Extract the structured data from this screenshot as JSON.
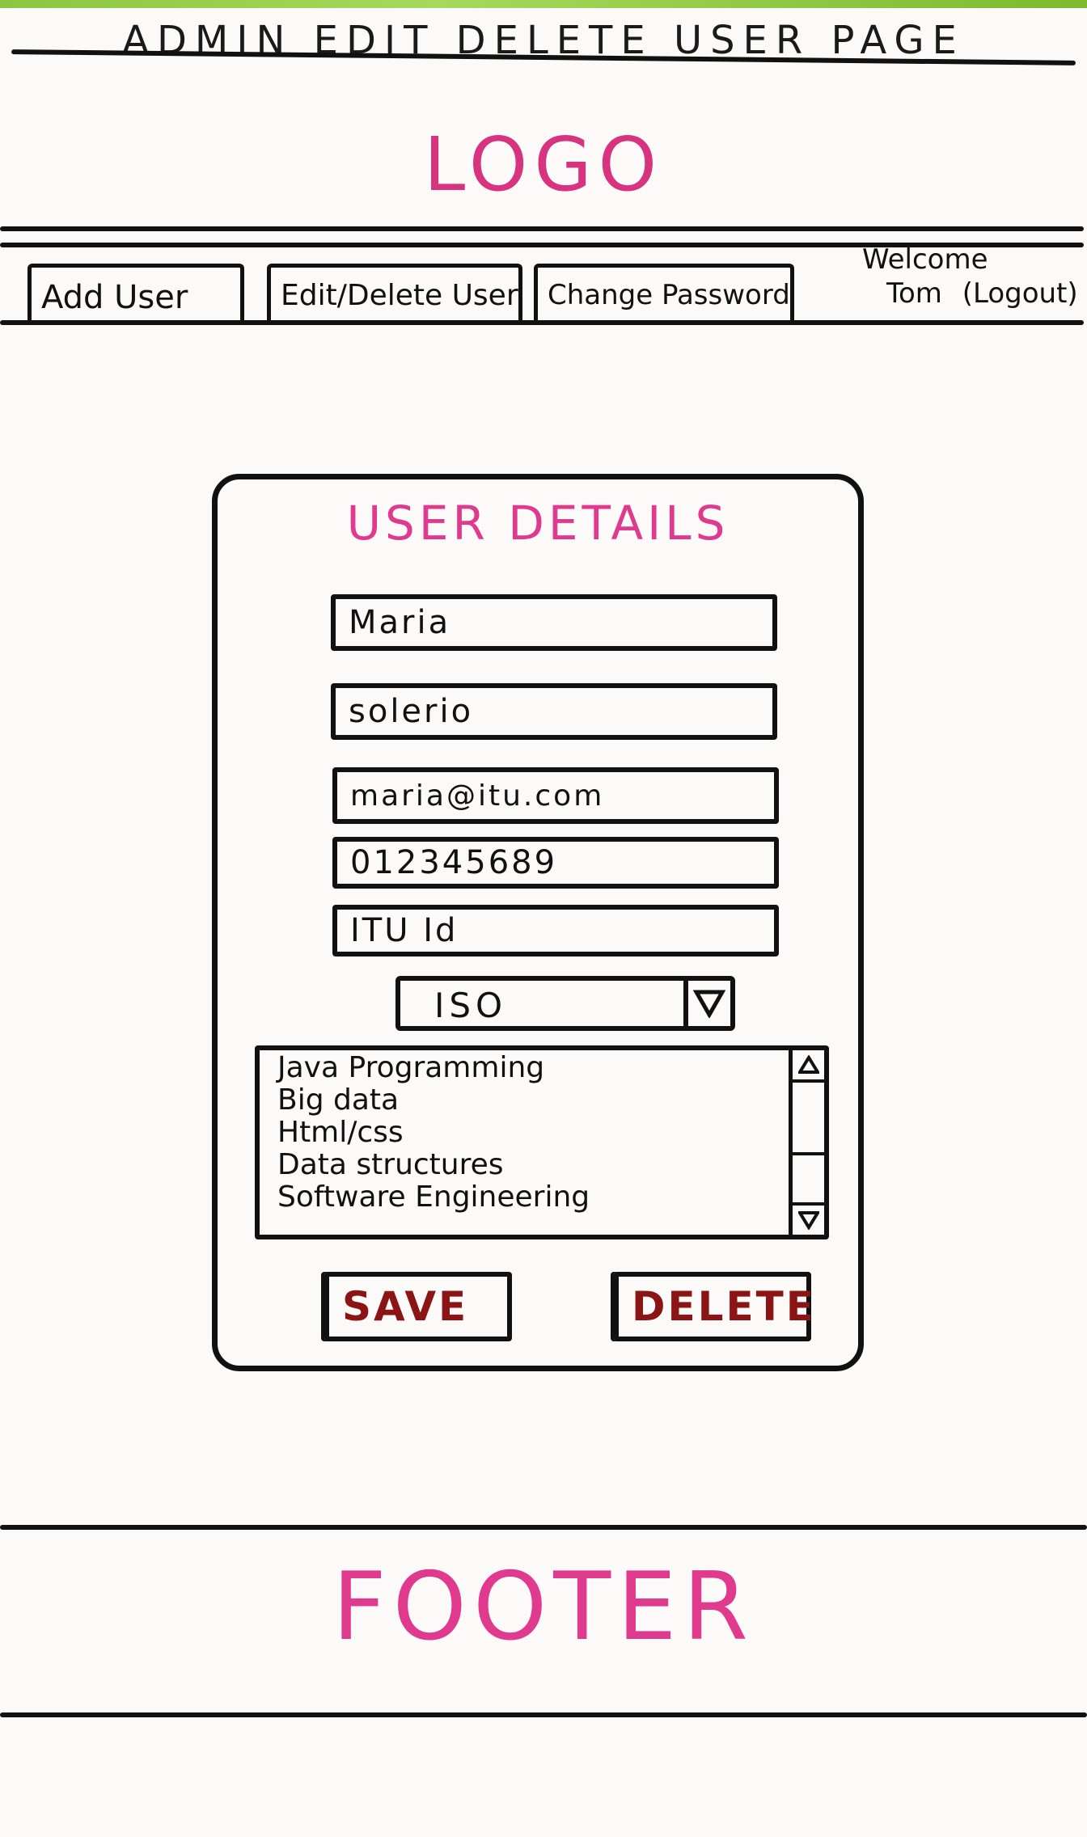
{
  "page": {
    "title": "ADMIN EDIT DELETE USER PAGE"
  },
  "header": {
    "logo": "LOGO"
  },
  "nav": {
    "tabs": [
      {
        "label": "Add User"
      },
      {
        "label": "Edit/Delete User"
      },
      {
        "label": "Change Password"
      }
    ],
    "welcome": "Welcome",
    "username": "Tom",
    "logout": "(Logout)"
  },
  "form": {
    "title": "USER DETAILS",
    "first_name": "Maria",
    "last_name": "solerio",
    "email": "maria@itu.com",
    "phone": "012345689",
    "id": "ITU Id",
    "role_select": {
      "value": "ISO"
    },
    "courses": [
      "Java Programming",
      "Big data",
      "Html/css",
      "Data structures",
      "Software Engineering"
    ],
    "save_label": "SAVE",
    "delete_label": "DELETE"
  },
  "footer": {
    "text": "FOOTER"
  },
  "colors": {
    "accent": "#e03a8e",
    "button_text": "#8b1414",
    "top_strip": "#8cc63f"
  }
}
